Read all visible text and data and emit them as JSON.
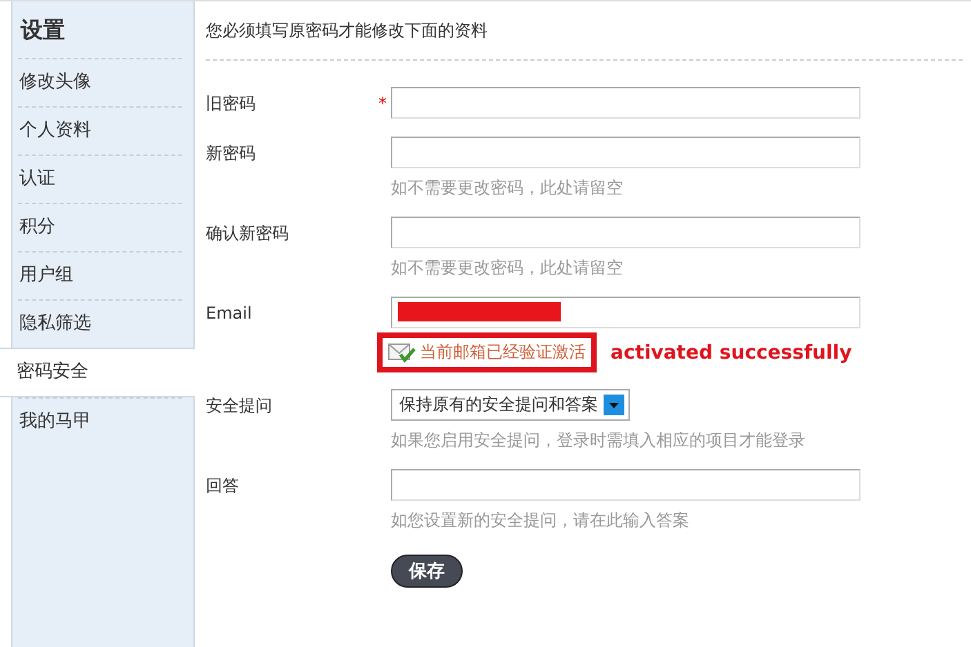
{
  "sidebar": {
    "title": "设置",
    "items": [
      {
        "label": "修改头像",
        "selected": false
      },
      {
        "label": "个人资料",
        "selected": false
      },
      {
        "label": "认证",
        "selected": false
      },
      {
        "label": "积分",
        "selected": false
      },
      {
        "label": "用户组",
        "selected": false
      },
      {
        "label": "隐私筛选",
        "selected": false
      },
      {
        "label": "密码安全",
        "selected": true
      },
      {
        "label": "我的马甲",
        "selected": false
      }
    ]
  },
  "notice": "您必须填写原密码才能修改下面的资料",
  "fields": [
    {
      "kind": "input",
      "label": "旧密码",
      "required_mark": "*"
    },
    {
      "kind": "input",
      "label": "新密码",
      "hint": "如不需要更改密码，此处请留空"
    },
    {
      "kind": "input",
      "label": "确认新密码",
      "hint": "如不需要更改密码，此处请留空"
    },
    {
      "kind": "email",
      "label": "Email",
      "redacted": true,
      "status": "当前邮箱已经验证激活",
      "annotation": "activated successfully"
    },
    {
      "kind": "select",
      "label": "安全提问",
      "value": "保持原有的安全提问和答案",
      "hint": "如果您启用安全提问，登录时需填入相应的项目才能登录"
    },
    {
      "kind": "input",
      "label": "回答",
      "hint": "如您设置新的安全提问，请在此输入答案"
    }
  ],
  "save_button": "保存"
}
